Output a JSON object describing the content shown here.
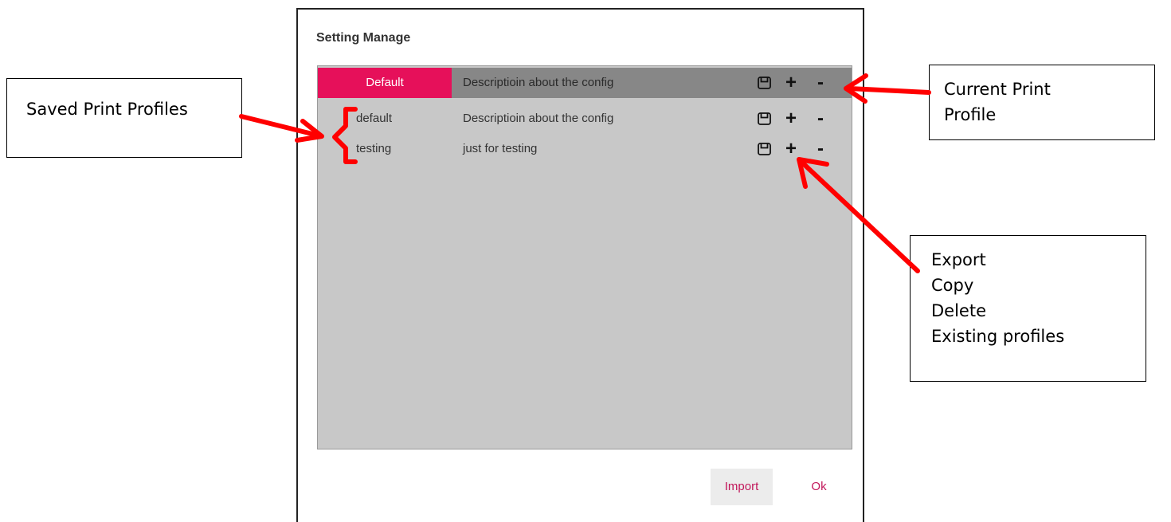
{
  "dialog": {
    "title": "Setting Manage",
    "current_profile": {
      "name": "Default",
      "description": "Descriptioin about the config"
    },
    "profiles": [
      {
        "name": "default",
        "description": "Descriptioin about the config"
      },
      {
        "name": "testing",
        "description": "just for testing"
      }
    ],
    "actions": {
      "export_icon": "save-icon",
      "copy_glyph": "+",
      "delete_glyph": "-"
    },
    "buttons": {
      "import_label": "Import",
      "ok_label": "Ok"
    }
  },
  "annotations": {
    "saved_profiles": [
      "Saved Print Profiles"
    ],
    "current_profile": [
      "Current Print",
      "Profile"
    ],
    "actions": [
      "Export",
      "Copy",
      "Delete",
      "Existing profiles"
    ]
  },
  "colors": {
    "accent": "#e6105a",
    "button_text": "#c2185b",
    "panel": "#c8c8c8",
    "current_row": "#878787",
    "annotation_arrow": "#ff0000"
  }
}
